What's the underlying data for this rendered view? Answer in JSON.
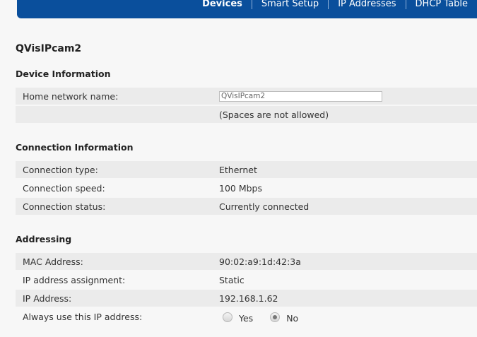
{
  "nav": {
    "items": [
      {
        "label": "Devices",
        "active": true
      },
      {
        "label": "Smart Setup",
        "active": false
      },
      {
        "label": "IP Addresses",
        "active": false
      },
      {
        "label": "DHCP Table",
        "active": false
      }
    ]
  },
  "device": {
    "title": "QVisIPcam2"
  },
  "device_info": {
    "title": "Device Information",
    "home_network_name_label": "Home network name:",
    "home_network_name_value": "QVisIPcam2",
    "spaces_note": "(Spaces are not allowed)"
  },
  "connection_info": {
    "title": "Connection Information",
    "rows": [
      {
        "label": "Connection type:",
        "value": "Ethernet"
      },
      {
        "label": "Connection speed:",
        "value": "100 Mbps"
      },
      {
        "label": "Connection status:",
        "value": "Currently connected"
      }
    ]
  },
  "addressing": {
    "title": "Addressing",
    "rows": [
      {
        "label": "MAC Address:",
        "value": "90:02:a9:1d:42:3a"
      },
      {
        "label": "IP address assignment:",
        "value": "Static"
      },
      {
        "label": "IP Address:",
        "value": "192.168.1.62"
      }
    ],
    "always_use_label": "Always use this IP address:",
    "yes_label": "Yes",
    "no_label": "No",
    "selected": "No"
  },
  "colors": {
    "topbar": "#0a4f9c",
    "row_shade": "#ebebeb",
    "background": "#f7f7f7"
  }
}
